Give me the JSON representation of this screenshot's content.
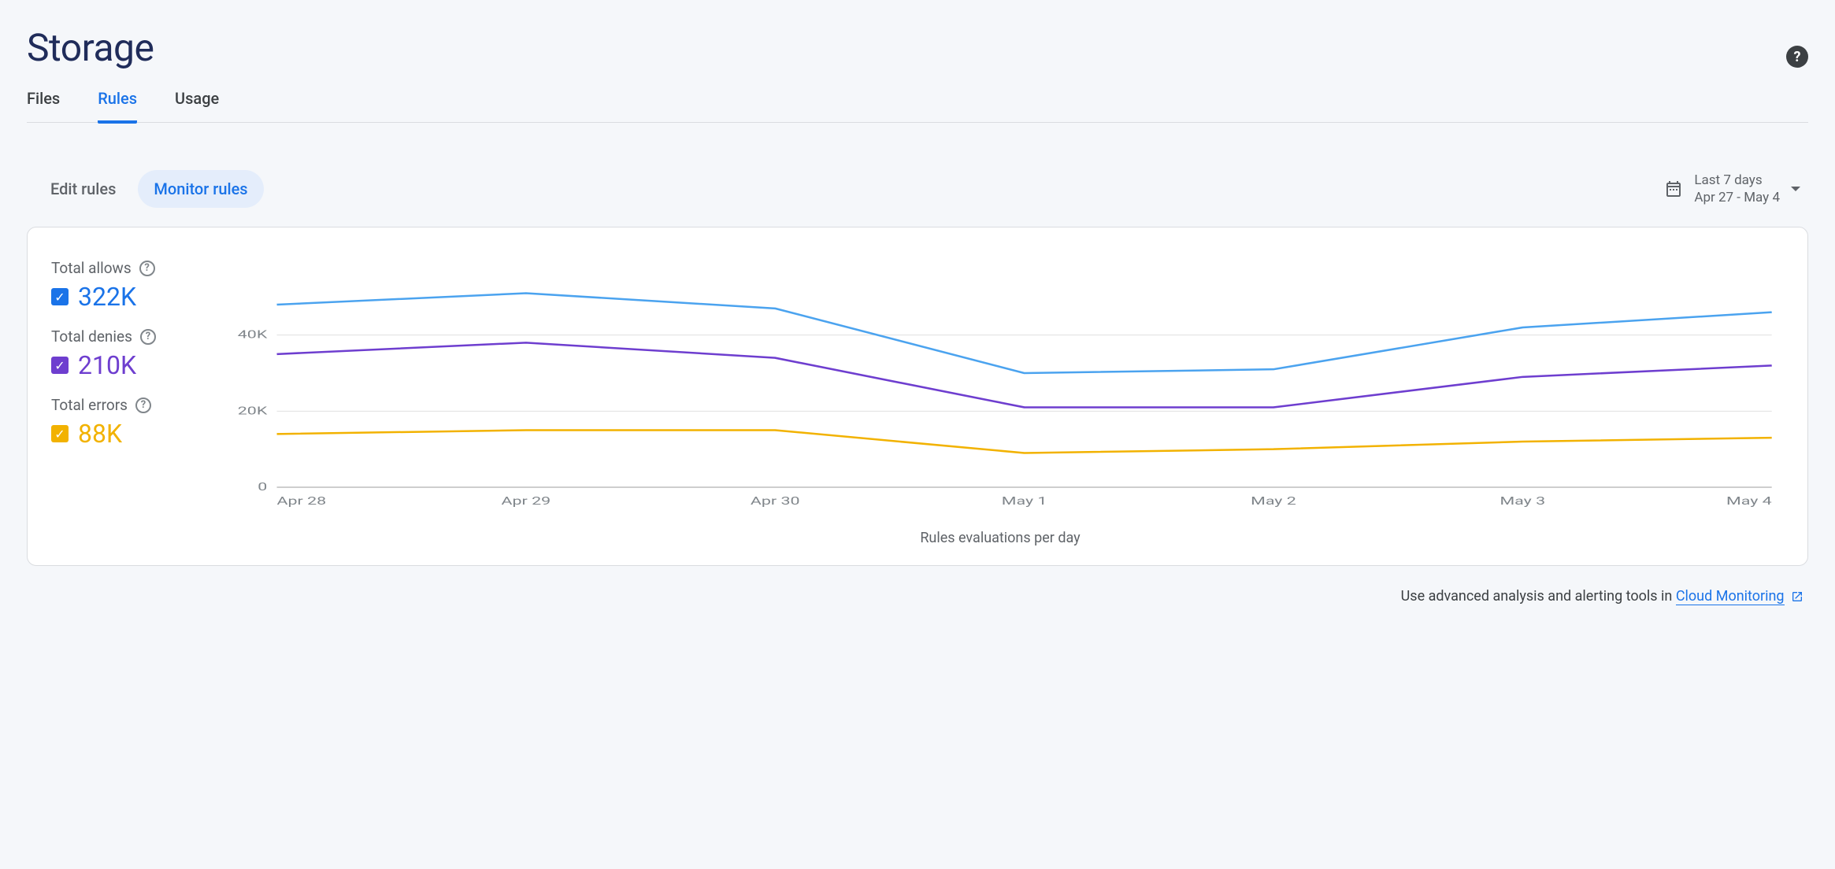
{
  "page_title": "Storage",
  "main_tabs": [
    {
      "label": "Files",
      "active": false
    },
    {
      "label": "Rules",
      "active": true
    },
    {
      "label": "Usage",
      "active": false
    }
  ],
  "sub_tabs": [
    {
      "label": "Edit rules",
      "active": false
    },
    {
      "label": "Monitor rules",
      "active": true
    }
  ],
  "date_picker": {
    "range_label": "Last 7 days",
    "range_value": "Apr 27 - May 4"
  },
  "legend": {
    "allows": {
      "label": "Total allows",
      "value": "322K"
    },
    "denies": {
      "label": "Total denies",
      "value": "210K"
    },
    "errors": {
      "label": "Total errors",
      "value": "88K"
    }
  },
  "chart_caption": "Rules evaluations per day",
  "chart_data": {
    "type": "line",
    "title": "Rules evaluations per day",
    "xlabel": "",
    "ylabel": "",
    "ylim": [
      0,
      60000
    ],
    "y_ticks": [
      0,
      20000,
      40000
    ],
    "y_tick_labels": [
      "0",
      "20K",
      "40K"
    ],
    "categories": [
      "Apr 28",
      "Apr 29",
      "Apr 30",
      "May 1",
      "May 2",
      "May 3",
      "May 4"
    ],
    "series": [
      {
        "name": "Total allows",
        "color": "#4ba3ef",
        "values": [
          48000,
          51000,
          47000,
          30000,
          31000,
          42000,
          46000
        ]
      },
      {
        "name": "Total denies",
        "color": "#6e3ecf",
        "values": [
          35000,
          38000,
          34000,
          21000,
          21000,
          29000,
          32000
        ]
      },
      {
        "name": "Total errors",
        "color": "#f2b200",
        "values": [
          14000,
          15000,
          15000,
          9000,
          10000,
          12000,
          13000
        ]
      }
    ]
  },
  "footer": {
    "prefix": "Use advanced analysis and alerting tools in ",
    "link_label": "Cloud Monitoring"
  }
}
